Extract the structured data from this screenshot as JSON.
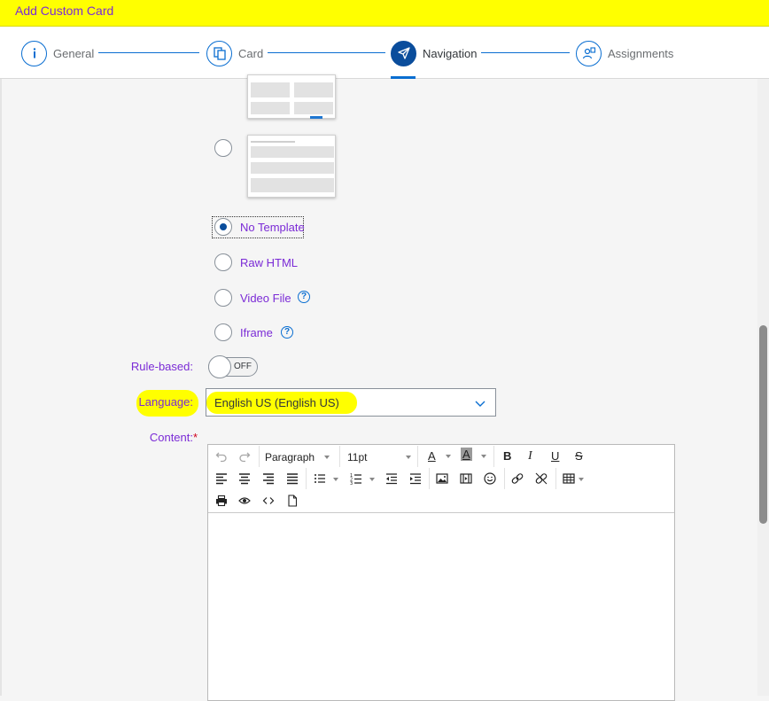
{
  "title": "Add Custom Card",
  "wizard": {
    "steps": [
      {
        "label": "General",
        "icon": "info-icon"
      },
      {
        "label": "Card",
        "icon": "card-copy-icon"
      },
      {
        "label": "Navigation",
        "icon": "paper-plane-icon",
        "active": true
      },
      {
        "label": "Assignments",
        "icon": "user-assign-icon"
      }
    ]
  },
  "templates": {
    "options": [
      {
        "label": "No Template",
        "selected": true
      },
      {
        "label": "Raw HTML"
      },
      {
        "label": "Video File",
        "help": "?"
      },
      {
        "label": "Iframe",
        "help": "?"
      }
    ]
  },
  "rule_based": {
    "label": "Rule-based:",
    "state": "OFF"
  },
  "language": {
    "label": "Language:",
    "value": "English US (English US)"
  },
  "content": {
    "label": "Content:",
    "required_marker": "*"
  },
  "editor": {
    "block_format": "Paragraph",
    "font_size": "11pt",
    "text_color_glyph": "A",
    "bg_color_glyph": "A",
    "bold_glyph": "B",
    "italic_glyph": "I",
    "underline_glyph": "U",
    "strike_glyph": "S"
  },
  "colors": {
    "highlight": "#ffff00",
    "label_purple": "#7b2bd6",
    "accent_blue": "#0a6ed1"
  }
}
